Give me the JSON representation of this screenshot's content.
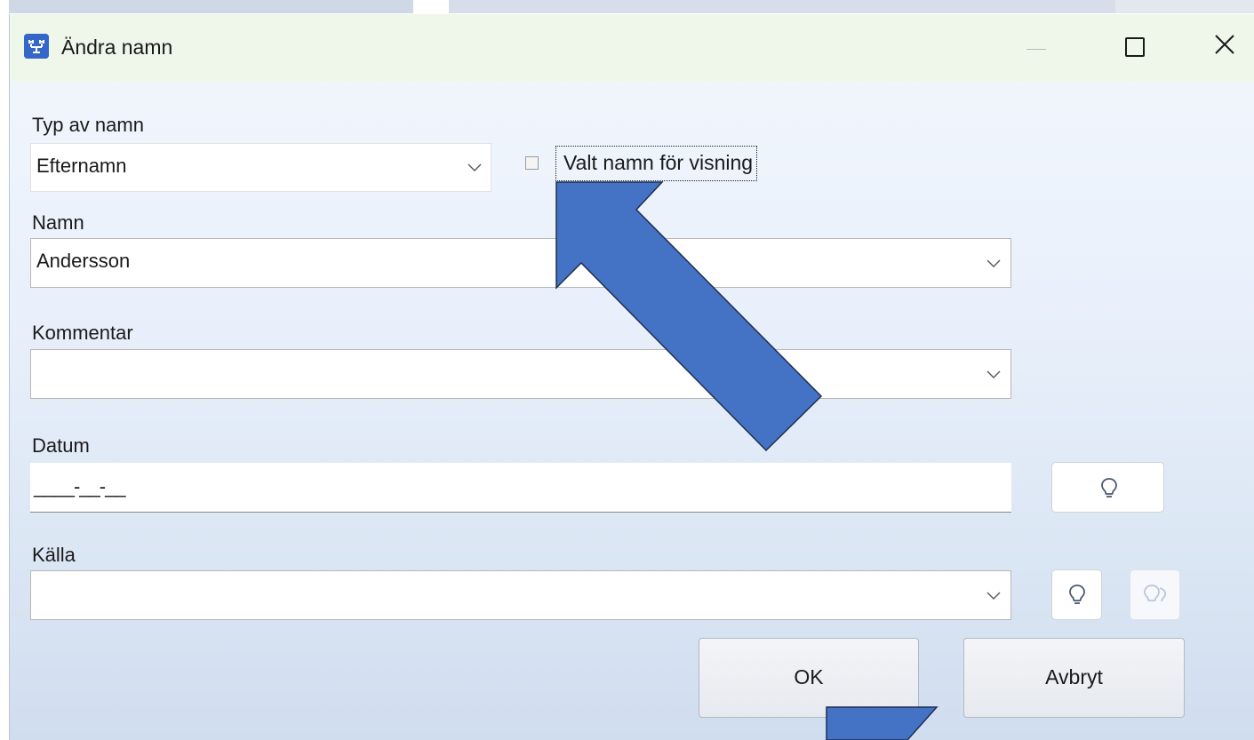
{
  "window": {
    "title": "Ändra namn",
    "app_icon_text": "⣿"
  },
  "form": {
    "name_type": {
      "label": "Typ av namn",
      "value": "Efternamn"
    },
    "preferred_checkbox": {
      "label": "Valt namn för visning",
      "checked": false
    },
    "name": {
      "label": "Namn",
      "value": "Andersson"
    },
    "comment": {
      "label": "Kommentar",
      "value": ""
    },
    "date": {
      "label": "Datum",
      "mask": "____-__-__"
    },
    "source": {
      "label": "Källa",
      "value": ""
    }
  },
  "buttons": {
    "ok": "OK",
    "cancel": "Avbryt"
  },
  "icons": {
    "app": "app-icon",
    "minimize": "minimize-icon",
    "maximize": "maximize-icon",
    "close": "close-icon",
    "date_hint": "lightbulb-icon",
    "source_hint": "lightbulb-icon",
    "source_hint2": "lightbulb-double-icon"
  },
  "colors": {
    "annotation_arrow": "#4472c4",
    "title_bar": "#eff7ea",
    "app_icon": "#3567c8"
  }
}
